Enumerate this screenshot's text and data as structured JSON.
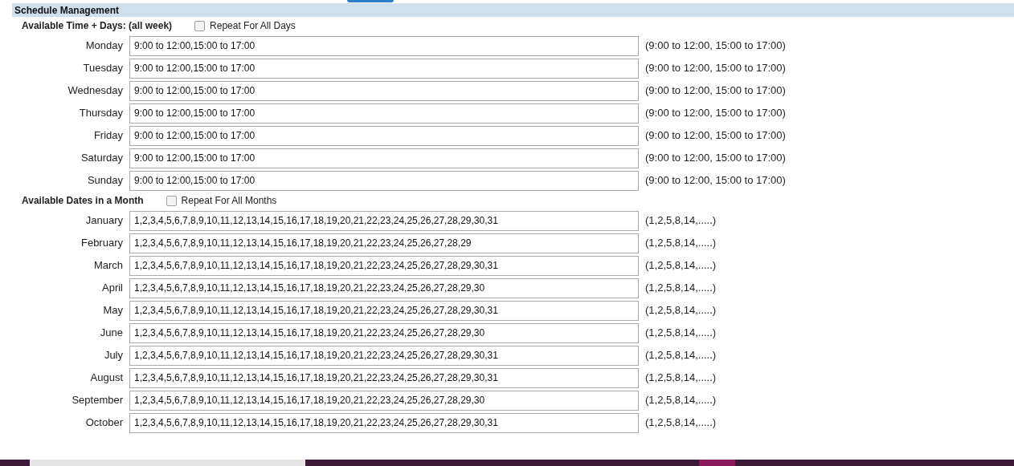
{
  "section_title": "Schedule Management",
  "week": {
    "label": "Available Time + Days: (all week)",
    "repeat": {
      "label": "Repeat For All Days",
      "checked": false
    },
    "rows": [
      {
        "label": "Monday",
        "value": "9:00 to 12:00,15:00 to 17:00",
        "hint": "(9:00 to 12:00, 15:00 to 17:00)"
      },
      {
        "label": "Tuesday",
        "value": "9:00 to 12:00,15:00 to 17:00",
        "hint": "(9:00 to 12:00, 15:00 to 17:00)"
      },
      {
        "label": "Wednesday",
        "value": "9:00 to 12:00,15:00 to 17:00",
        "hint": "(9:00 to 12:00, 15:00 to 17:00)"
      },
      {
        "label": "Thursday",
        "value": "9:00 to 12:00,15:00 to 17:00",
        "hint": "(9:00 to 12:00, 15:00 to 17:00)"
      },
      {
        "label": "Friday",
        "value": "9:00 to 12:00,15:00 to 17:00",
        "hint": "(9:00 to 12:00, 15:00 to 17:00)"
      },
      {
        "label": "Saturday",
        "value": "9:00 to 12:00,15:00 to 17:00",
        "hint": "(9:00 to 12:00, 15:00 to 17:00)"
      },
      {
        "label": "Sunday",
        "value": "9:00 to 12:00,15:00 to 17:00",
        "hint": "(9:00 to 12:00, 15:00 to 17:00)"
      }
    ]
  },
  "month": {
    "label": "Available Dates in a Month",
    "repeat": {
      "label": "Repeat For All Months",
      "checked": false
    },
    "rows": [
      {
        "label": "January",
        "value": "1,2,3,4,5,6,7,8,9,10,11,12,13,14,15,16,17,18,19,20,21,22,23,24,25,26,27,28,29,30,31",
        "hint": "(1,2,5,8,14,.....)"
      },
      {
        "label": "February",
        "value": "1,2,3,4,5,6,7,8,9,10,11,12,13,14,15,16,17,18,19,20,21,22,23,24,25,26,27,28,29",
        "hint": "(1,2,5,8,14,.....)"
      },
      {
        "label": "March",
        "value": "1,2,3,4,5,6,7,8,9,10,11,12,13,14,15,16,17,18,19,20,21,22,23,24,25,26,27,28,29,30,31",
        "hint": "(1,2,5,8,14,.....)"
      },
      {
        "label": "April",
        "value": "1,2,3,4,5,6,7,8,9,10,11,12,13,14,15,16,17,18,19,20,21,22,23,24,25,26,27,28,29,30",
        "hint": "(1,2,5,8,14,.....)"
      },
      {
        "label": "May",
        "value": "1,2,3,4,5,6,7,8,9,10,11,12,13,14,15,16,17,18,19,20,21,22,23,24,25,26,27,28,29,30,31",
        "hint": "(1,2,5,8,14,.....)"
      },
      {
        "label": "June",
        "value": "1,2,3,4,5,6,7,8,9,10,11,12,13,14,15,16,17,18,19,20,21,22,23,24,25,26,27,28,29,30",
        "hint": "(1,2,5,8,14,.....)"
      },
      {
        "label": "July",
        "value": "1,2,3,4,5,6,7,8,9,10,11,12,13,14,15,16,17,18,19,20,21,22,23,24,25,26,27,28,29,30,31",
        "hint": "(1,2,5,8,14,.....)"
      },
      {
        "label": "August",
        "value": "1,2,3,4,5,6,7,8,9,10,11,12,13,14,15,16,17,18,19,20,21,22,23,24,25,26,27,28,29,30,31",
        "hint": "(1,2,5,8,14,.....)"
      },
      {
        "label": "September",
        "value": "1,2,3,4,5,6,7,8,9,10,11,12,13,14,15,16,17,18,19,20,21,22,23,24,25,26,27,28,29,30",
        "hint": "(1,2,5,8,14,.....)"
      },
      {
        "label": "October",
        "value": "1,2,3,4,5,6,7,8,9,10,11,12,13,14,15,16,17,18,19,20,21,22,23,24,25,26,27,28,29,30,31",
        "hint": "(1,2,5,8,14,.....)"
      }
    ]
  }
}
